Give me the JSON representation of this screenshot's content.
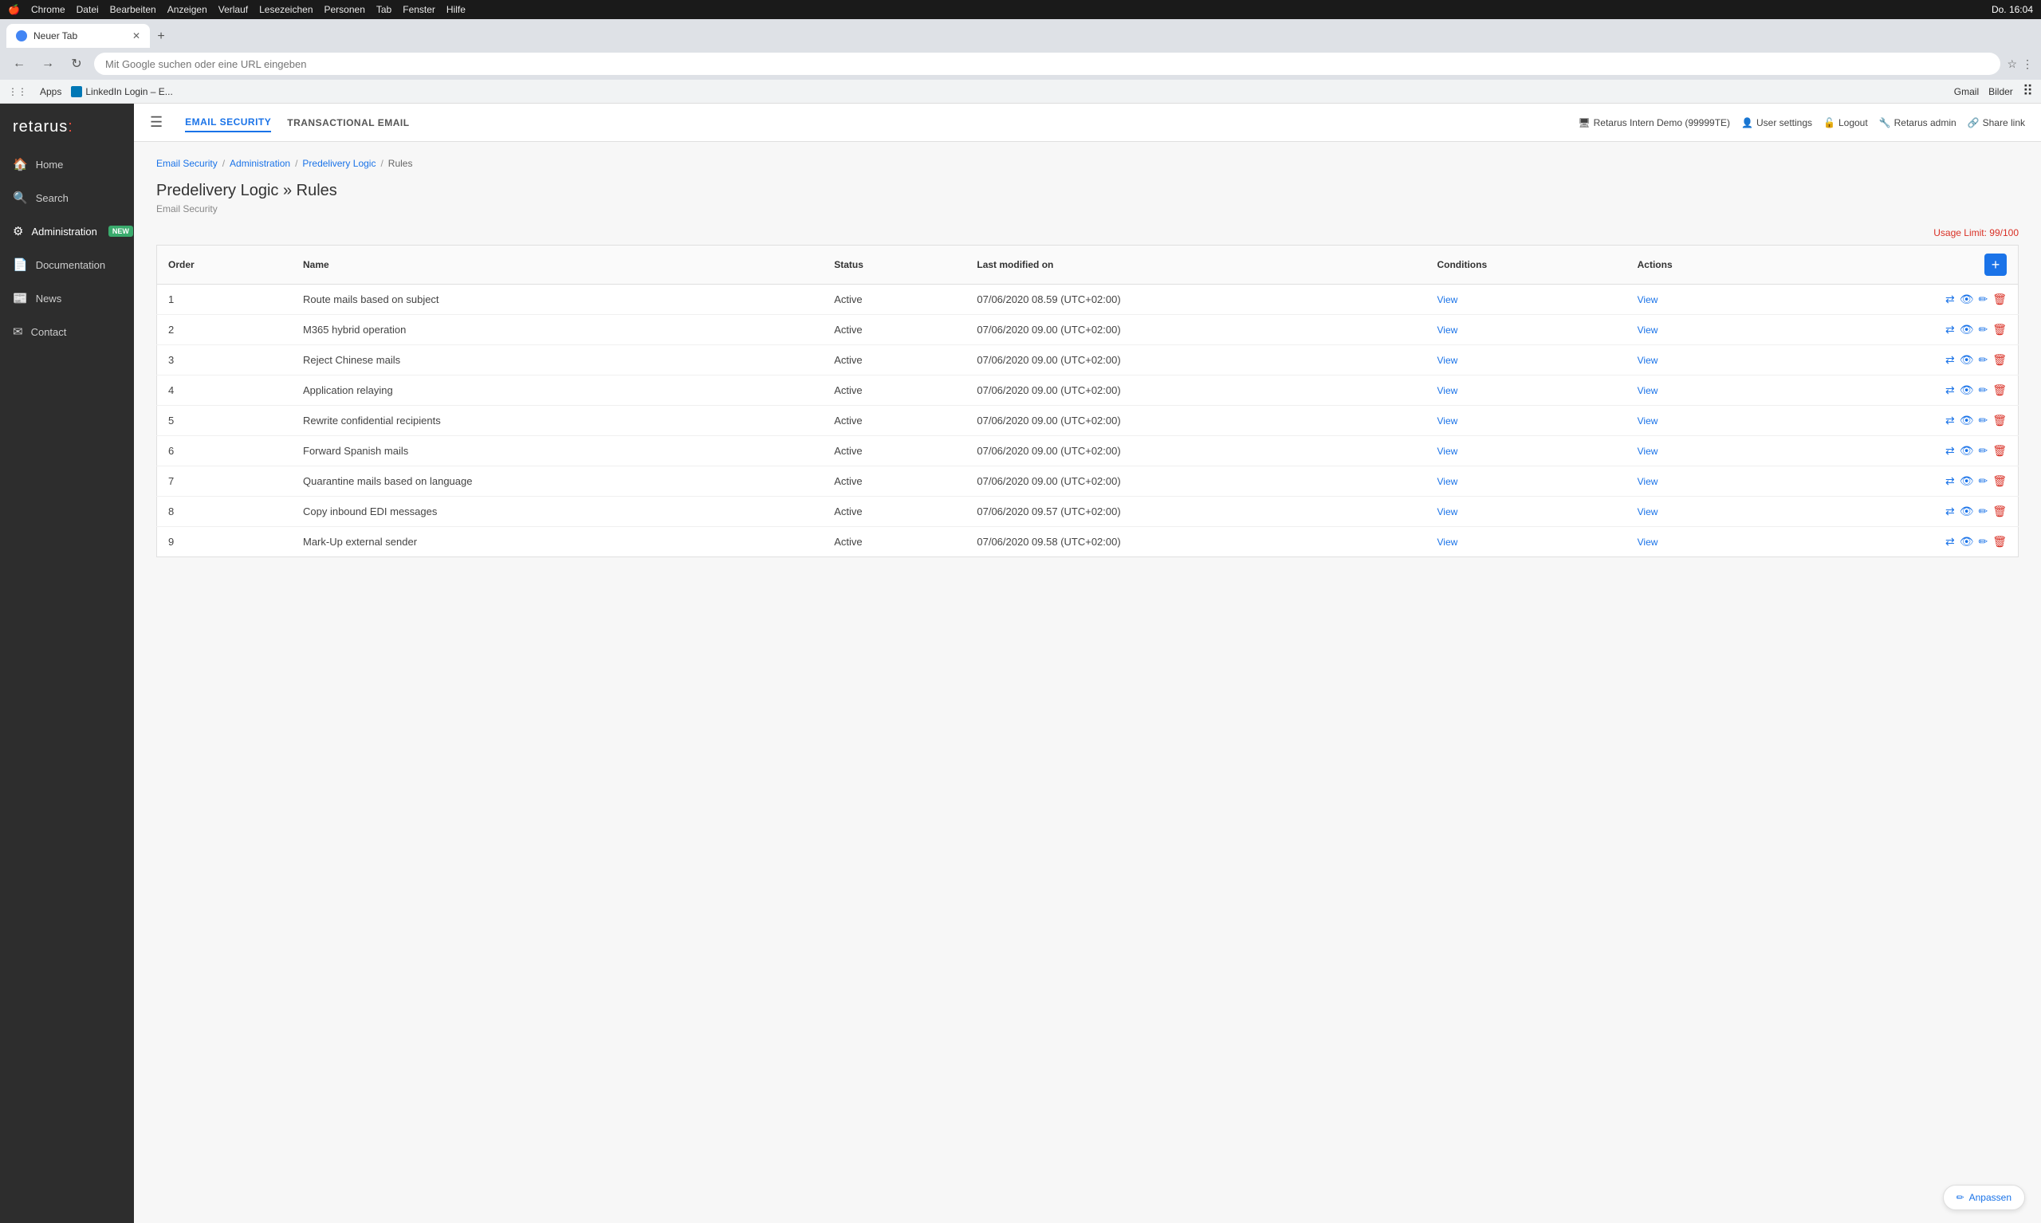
{
  "macos": {
    "apple": "🍎",
    "app": "Chrome",
    "menus": [
      "Datei",
      "Bearbeiten",
      "Anzeigen",
      "Verlauf",
      "Lesezeichen",
      "Personen",
      "Tab",
      "Fenster",
      "Hilfe"
    ],
    "time": "Do. 16:04"
  },
  "browser": {
    "tab_title": "Neuer Tab",
    "address": "Mit Google suchen oder eine URL eingeben",
    "bookmarks": [
      "Apps",
      "LinkedIn Login – E..."
    ],
    "right_apps": [
      "Gmail",
      "Bilder"
    ]
  },
  "top_nav": {
    "hamburger": "☰",
    "links": [
      {
        "label": "EMAIL SECURITY",
        "active": true
      },
      {
        "label": "TRANSACTIONAL EMAIL",
        "active": false
      }
    ],
    "right_items": [
      {
        "icon": "🖥",
        "label": "Retarus Intern Demo (99999TE)"
      },
      {
        "icon": "👤",
        "label": "User settings"
      },
      {
        "icon": "🔓",
        "label": "Logout"
      },
      {
        "icon": "🔧",
        "label": "Retarus admin"
      },
      {
        "icon": "🔗",
        "label": "Share link"
      }
    ]
  },
  "sidebar": {
    "logo": "retarus:",
    "items": [
      {
        "icon": "🏠",
        "label": "Home",
        "active": false,
        "badge": null
      },
      {
        "icon": "🔍",
        "label": "Search",
        "active": false,
        "badge": null
      },
      {
        "icon": "⚙",
        "label": "Administration",
        "active": true,
        "badge": "NEW"
      },
      {
        "icon": "📄",
        "label": "Documentation",
        "active": false,
        "badge": null
      },
      {
        "icon": "📰",
        "label": "News",
        "active": false,
        "badge": null
      },
      {
        "icon": "✉",
        "label": "Contact",
        "active": false,
        "badge": null
      }
    ]
  },
  "breadcrumb": {
    "items": [
      "Email Security",
      "Administration",
      "Predelivery Logic",
      "Rules"
    ],
    "separator": "/"
  },
  "page": {
    "title": "Predelivery Logic » Rules",
    "subtitle": "Email Security",
    "usage_limit": "Usage Limit: 99/100"
  },
  "table": {
    "headers": [
      "Order",
      "Name",
      "Status",
      "Last modified on",
      "Conditions",
      "Actions",
      ""
    ],
    "rows": [
      {
        "order": 1,
        "name": "Route mails based on subject",
        "status": "Active",
        "modified": "07/06/2020 08.59 (UTC+02:00)"
      },
      {
        "order": 2,
        "name": "M365 hybrid operation",
        "status": "Active",
        "modified": "07/06/2020 09.00 (UTC+02:00)"
      },
      {
        "order": 3,
        "name": "Reject Chinese mails",
        "status": "Active",
        "modified": "07/06/2020 09.00 (UTC+02:00)"
      },
      {
        "order": 4,
        "name": "Application relaying",
        "status": "Active",
        "modified": "07/06/2020 09.00 (UTC+02:00)"
      },
      {
        "order": 5,
        "name": "Rewrite confidential recipients",
        "status": "Active",
        "modified": "07/06/2020 09.00 (UTC+02:00)"
      },
      {
        "order": 6,
        "name": "Forward Spanish mails",
        "status": "Active",
        "modified": "07/06/2020 09.00 (UTC+02:00)"
      },
      {
        "order": 7,
        "name": "Quarantine mails based on language",
        "status": "Active",
        "modified": "07/06/2020 09.00 (UTC+02:00)"
      },
      {
        "order": 8,
        "name": "Copy inbound EDI messages",
        "status": "Active",
        "modified": "07/06/2020 09.57 (UTC+02:00)"
      },
      {
        "order": 9,
        "name": "Mark-Up external sender",
        "status": "Active",
        "modified": "07/06/2020 09.58 (UTC+02:00)"
      }
    ],
    "view_label": "View",
    "add_button": "+"
  },
  "anpassen": {
    "icon": "✏",
    "label": "Anpassen"
  }
}
